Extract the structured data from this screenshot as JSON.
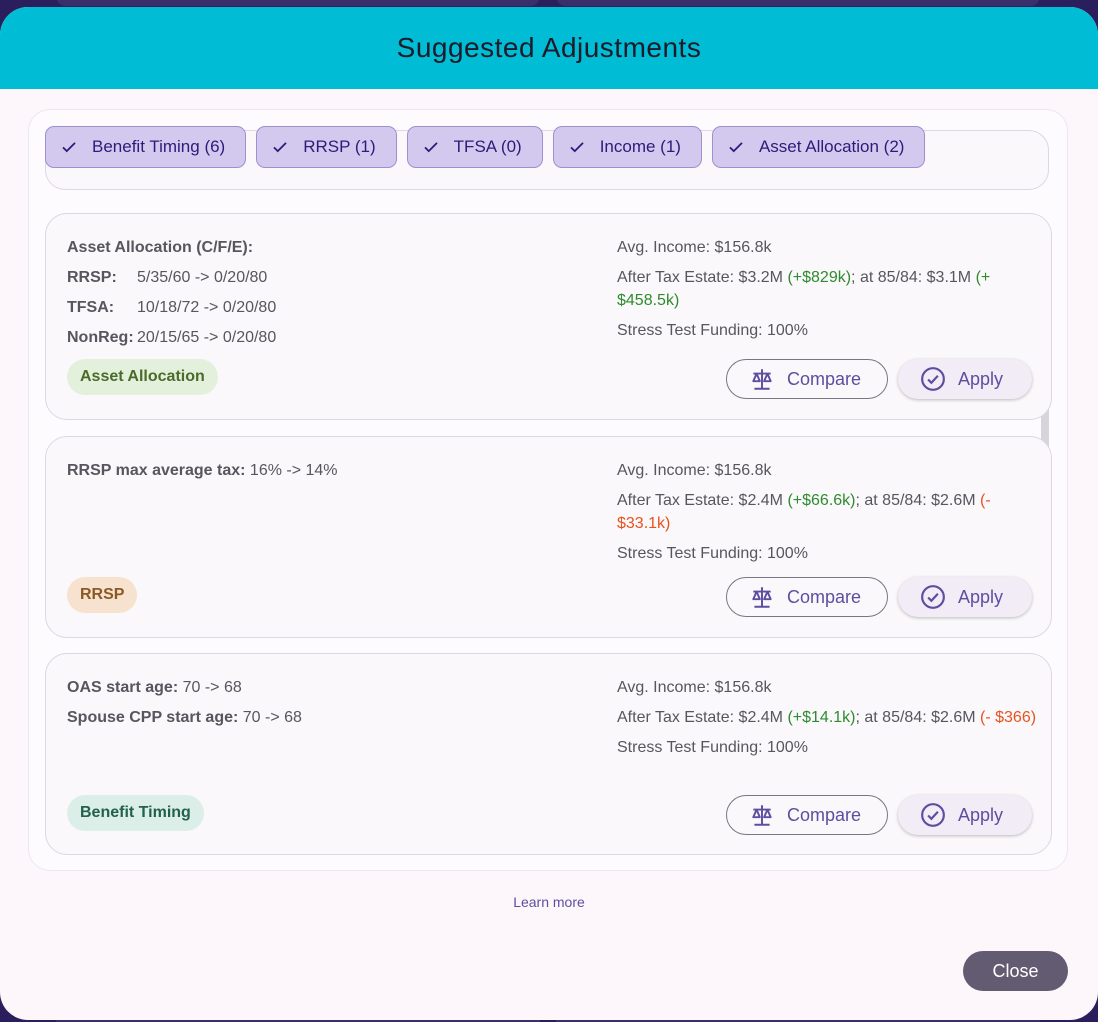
{
  "dialog": {
    "title": "Suggested Adjustments",
    "learn_more": "Learn more",
    "close_label": "Close"
  },
  "filters": [
    {
      "label": "Benefit Timing (6)",
      "checked": true
    },
    {
      "label": "RRSP (1)",
      "checked": true
    },
    {
      "label": "TFSA (0)",
      "checked": true
    },
    {
      "label": "Income (1)",
      "checked": true
    },
    {
      "label": "Asset Allocation (2)",
      "checked": true
    }
  ],
  "cards": [
    {
      "heading": "Asset Allocation (C/F/E):",
      "rows": [
        {
          "label": "RRSP:",
          "value": "5/35/60 -> 0/20/80"
        },
        {
          "label": "TFSA:",
          "value": "10/18/72 -> 0/20/80"
        },
        {
          "label": "NonReg:",
          "value": "20/15/65 -> 0/20/80"
        }
      ],
      "avg_income": "Avg. Income: $156.8k",
      "estate_prefix": "After Tax Estate: $3.2M ",
      "estate_delta": "(+$829k)",
      "estate_mid": "; at 85/84: $3.1M ",
      "estate_delta2": "(+ $458.5k)",
      "stress": "Stress Test Funding: 100%",
      "tag": "Asset Allocation",
      "compare_label": "Compare",
      "apply_label": "Apply"
    },
    {
      "line1_label": "RRSP max average tax:",
      "line1_value": " 16% -> 14%",
      "avg_income": "Avg. Income: $156.8k",
      "estate_prefix": "After Tax Estate: $2.4M ",
      "estate_delta": "(+$66.6k)",
      "estate_mid": "; at 85/84: $2.6M ",
      "estate_delta2": "(- $33.1k)",
      "stress": "Stress Test Funding: 100%",
      "tag": "RRSP",
      "compare_label": "Compare",
      "apply_label": "Apply"
    },
    {
      "line1_label": "OAS start age:",
      "line1_value": " 70 -> 68",
      "line2_label": "Spouse CPP start age:",
      "line2_value": " 70 -> 68",
      "avg_income": "Avg. Income: $156.8k",
      "estate_prefix": "After Tax Estate: $2.4M ",
      "estate_delta": "(+$14.1k)",
      "estate_mid": "; at 85/84: $2.6M ",
      "estate_delta2": "(- $366)",
      "stress": "Stress Test Funding: 100%",
      "tag": "Benefit Timing",
      "compare_label": "Compare",
      "apply_label": "Apply"
    }
  ],
  "icons": {
    "check": "check-icon",
    "compare": "balance-scale-icon",
    "apply": "check-circle-icon"
  },
  "colors": {
    "header": "#00bcd4",
    "positive": "#2e8b2e",
    "negative": "#e8521f",
    "accent": "#5d4ea0"
  }
}
